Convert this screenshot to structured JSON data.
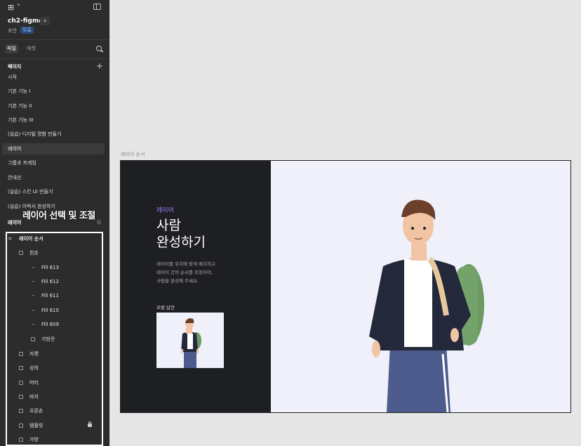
{
  "app": {
    "file_name": "ch2-figma",
    "draft_label": "초안",
    "plan_badge": "무료",
    "accent_color": "#9b86f5"
  },
  "tabs": [
    {
      "label": "파일",
      "active": true
    },
    {
      "label": "에셋",
      "active": false
    }
  ],
  "pages": {
    "title": "페이지",
    "items": [
      "시작",
      "기본 기능 I",
      "기본 기능 II",
      "기본 기능 III",
      "(실습) 디지털 명함 만들기",
      "레이어",
      "그룹과 프레임",
      "안내선",
      "(실습) 스킨 UI 만들기",
      "(실습) 이력서 완성하기"
    ],
    "active_index": 5
  },
  "layers": {
    "title": "레이어",
    "overlay_annotation": "레이어 선택 및 조절",
    "root": "레이어 순서",
    "items": [
      {
        "label": "왼손",
        "indent": 1,
        "icon": "frame"
      },
      {
        "label": "Fill 613",
        "indent": 2,
        "icon": "vector"
      },
      {
        "label": "Fill 612",
        "indent": 2,
        "icon": "vector"
      },
      {
        "label": "Fill 611",
        "indent": 2,
        "icon": "vector"
      },
      {
        "label": "Fill 610",
        "indent": 2,
        "icon": "vector"
      },
      {
        "label": "Fill 609",
        "indent": 2,
        "icon": "vector"
      },
      {
        "label": "가방끈",
        "indent": 2,
        "icon": "frame"
      },
      {
        "label": "자켓",
        "indent": 1,
        "icon": "frame"
      },
      {
        "label": "상의",
        "indent": 1,
        "icon": "frame"
      },
      {
        "label": "머리",
        "indent": 1,
        "icon": "frame"
      },
      {
        "label": "바지",
        "indent": 1,
        "icon": "frame"
      },
      {
        "label": "오른손",
        "indent": 1,
        "icon": "frame"
      },
      {
        "label": "템플릿",
        "indent": 1,
        "icon": "frame",
        "locked": true
      },
      {
        "label": "가방",
        "indent": 1,
        "icon": "frame"
      }
    ]
  },
  "canvas": {
    "frame_label": "레이어 순서",
    "kicker": "레이어",
    "title_line1": "사람",
    "title_line2": "완성하기",
    "desc_line1": "레이어를 위치에 맞게 배치하고",
    "desc_line2": "레이어 간의 순서를 조정하여,",
    "desc_line3": "사람을 완성해 주세요.",
    "answer_label": "모범 답안"
  }
}
